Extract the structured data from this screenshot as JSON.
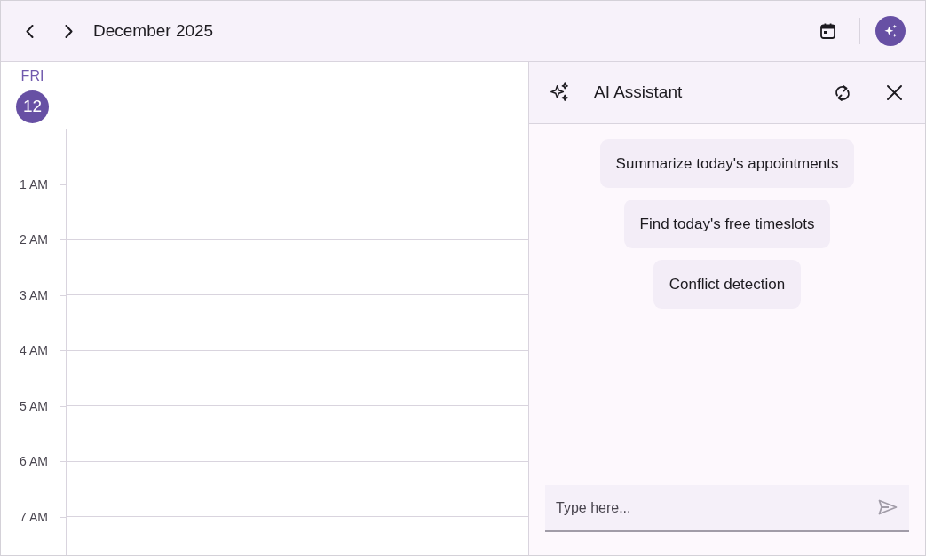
{
  "header": {
    "title": "December 2025"
  },
  "day": {
    "weekday": "FRI",
    "date": "12",
    "today": true
  },
  "time_labels": [
    "1 AM",
    "2 AM",
    "3 AM",
    "4 AM",
    "5 AM",
    "6 AM",
    "7 AM"
  ],
  "assistant": {
    "title": "AI Assistant",
    "suggestions": [
      "Summarize today's appointments",
      "Find today's free timeslots",
      "Conflict detection"
    ],
    "input": {
      "placeholder": "Type here..."
    }
  }
}
